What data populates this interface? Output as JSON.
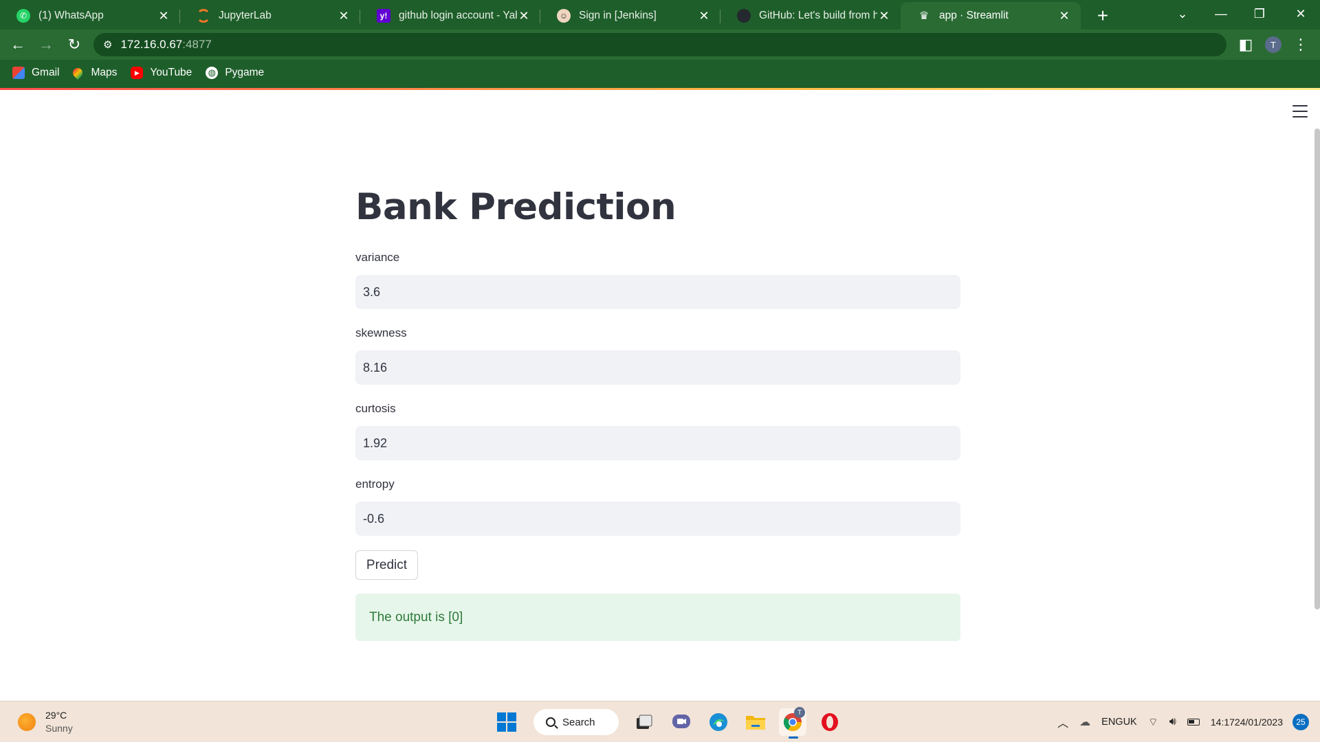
{
  "browser": {
    "tabs": [
      {
        "title": "(1) WhatsApp",
        "icon": "whatsapp-icon",
        "color": "#25d366"
      },
      {
        "title": "JupyterLab",
        "icon": "jupyter-icon",
        "color": "#f37726"
      },
      {
        "title": "github login account - Yahoo",
        "icon": "yahoo-icon",
        "color": "#6001d2"
      },
      {
        "title": "Sign in [Jenkins]",
        "icon": "jenkins-icon",
        "color": "#d24939"
      },
      {
        "title": "GitHub: Let's build from here",
        "icon": "github-icon",
        "color": "#24292f"
      },
      {
        "title": "app · Streamlit",
        "icon": "streamlit-icon",
        "color": "#ff4b4b"
      }
    ],
    "active_tab_index": 5,
    "address": {
      "host": "172.16.0.67",
      "port": ":4877"
    },
    "profile_initial": "T",
    "bookmarks": [
      {
        "label": "Gmail",
        "icon": "gmail-icon"
      },
      {
        "label": "Maps",
        "icon": "maps-icon"
      },
      {
        "label": "YouTube",
        "icon": "youtube-icon"
      },
      {
        "label": "Pygame",
        "icon": "globe-icon"
      }
    ]
  },
  "app": {
    "title": "Bank Prediction",
    "fields": [
      {
        "label": "variance",
        "value": "3.6"
      },
      {
        "label": "skewness",
        "value": "8.16"
      },
      {
        "label": "curtosis",
        "value": "1.92"
      },
      {
        "label": "entropy",
        "value": "-0.6"
      }
    ],
    "predict_label": "Predict",
    "result": "The output is [0]"
  },
  "taskbar": {
    "weather": {
      "temp": "29°C",
      "condition": "Sunny"
    },
    "search_label": "Search",
    "language": {
      "top": "ENG",
      "bottom": "UK"
    },
    "clock": {
      "time": "14:17",
      "date": "24/01/2023"
    },
    "notifications": "25",
    "chrome_badge": "T"
  }
}
